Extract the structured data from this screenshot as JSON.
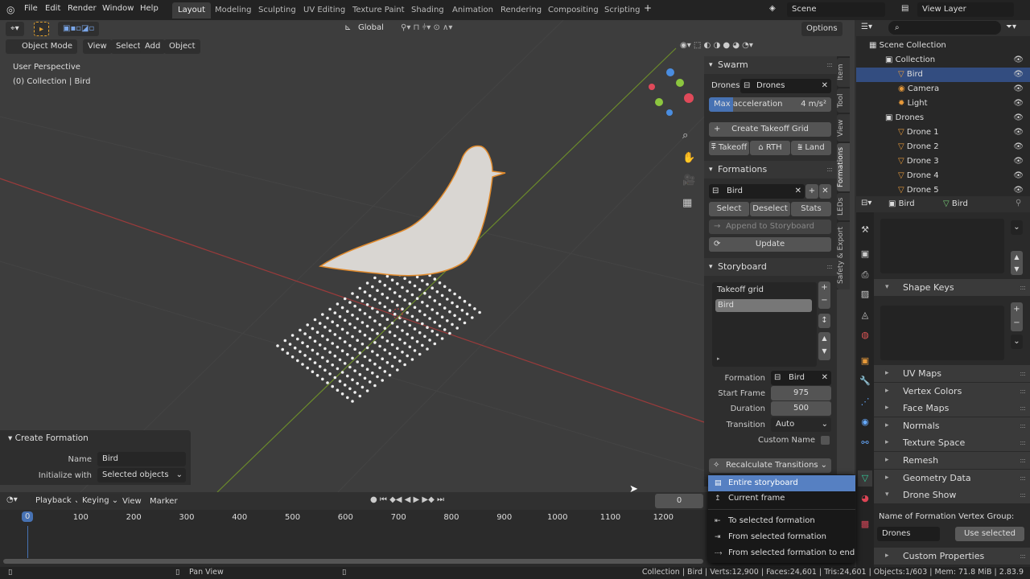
{
  "topbar": {
    "menus": [
      "File",
      "Edit",
      "Render",
      "Window",
      "Help"
    ],
    "workspaces": [
      "Layout",
      "Modeling",
      "Sculpting",
      "UV Editing",
      "Texture Paint",
      "Shading",
      "Animation",
      "Rendering",
      "Compositing",
      "Scripting"
    ],
    "active_workspace": "Layout",
    "add_tab": "+",
    "scene": "Scene",
    "view_layer": "View Layer"
  },
  "viewport": {
    "transform_orientation": "Global",
    "options": "Options",
    "mode": "Object Mode",
    "menus": [
      "View",
      "Select",
      "Add",
      "Object"
    ],
    "view_name": "User Perspective",
    "collection_info": "(0) Collection | Bird"
  },
  "operator_panel": {
    "title": "Create Formation",
    "name_label": "Name",
    "name_value": "Bird",
    "init_label": "Initialize with",
    "init_value": "Selected objects"
  },
  "npanel": {
    "tabs": [
      "Item",
      "Tool",
      "View",
      "Formations",
      "LEDs",
      "Safety & Export"
    ],
    "swarm": {
      "title": "Swarm",
      "drones_label": "Drones:",
      "drones_value": "Drones",
      "max_accel_label": "Max acceleration",
      "max_accel_value": "4 m/s²",
      "max_accel_fraction": 0.2,
      "create_takeoff": "Create Takeoff Grid",
      "takeoff": "Takeoff",
      "rth": "RTH",
      "land": "Land"
    },
    "formations": {
      "title": "Formations",
      "selected": "Bird",
      "select": "Select",
      "deselect": "Deselect",
      "stats": "Stats",
      "append": "Append to Storyboard",
      "update": "Update"
    },
    "storyboard": {
      "title": "Storyboard",
      "items": [
        "Takeoff grid",
        "Bird"
      ],
      "formation_label": "Formation",
      "formation_value": "Bird",
      "start_frame_label": "Start Frame",
      "start_frame": "975",
      "duration_label": "Duration",
      "duration": "500",
      "transition_label": "Transition",
      "transition": "Auto",
      "custom_name_label": "Custom Name",
      "recalc": "Recalculate Transitions"
    }
  },
  "dropdown": {
    "items": [
      "Entire storyboard",
      "Current frame",
      "To selected formation",
      "From selected formation",
      "From selected formation to end"
    ]
  },
  "outliner": {
    "root": "Scene Collection",
    "rows": [
      {
        "name": "Collection"
      },
      {
        "name": "Bird"
      },
      {
        "name": "Camera"
      },
      {
        "name": "Light"
      },
      {
        "name": "Drones"
      },
      {
        "name": "Drone 1"
      },
      {
        "name": "Drone 2"
      },
      {
        "name": "Drone 3"
      },
      {
        "name": "Drone 4"
      },
      {
        "name": "Drone 5"
      }
    ]
  },
  "properties": {
    "object": "Bird",
    "mesh": "Bird",
    "shape_keys": "Shape Keys",
    "sections": [
      "UV Maps",
      "Vertex Colors",
      "Face Maps",
      "Normals",
      "Texture Space",
      "Remesh",
      "Geometry Data"
    ],
    "drone_show": "Drone Show",
    "vg_label": "Name of Formation Vertex Group:",
    "vg_value": "Drones",
    "use_selected": "Use selected",
    "custom_props": "Custom Properties"
  },
  "timeline": {
    "menus": [
      "Playback",
      "Keying",
      "View",
      "Marker"
    ],
    "current_frame": "0",
    "ticks": [
      "0",
      "100",
      "200",
      "300",
      "400",
      "500",
      "600",
      "700",
      "800",
      "900",
      "1000",
      "1100",
      "1200"
    ]
  },
  "status": {
    "pan_view": "Pan View",
    "stats": "Collection | Bird | Verts:12,900 | Faces:24,601 | Tris:24,601 | Objects:1/603 | Mem: 71.8 MiB | 2.83.9"
  }
}
